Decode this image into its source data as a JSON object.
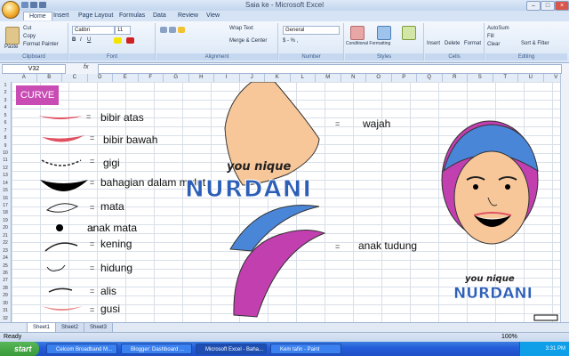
{
  "window": {
    "title": "Saia ke - Microsoft Excel"
  },
  "tabs": [
    "Home",
    "Insert",
    "Page Layout",
    "Formulas",
    "Data",
    "Review",
    "View"
  ],
  "ribbon": {
    "clipboard": {
      "paste": "Paste",
      "cut": "Cut",
      "copy": "Copy",
      "format_painter": "Format Painter",
      "label": "Clipboard"
    },
    "font": {
      "name": "Calibri",
      "size": "11",
      "label": "Font"
    },
    "alignment": {
      "wrap": "Wrap Text",
      "merge": "Merge & Center",
      "label": "Alignment"
    },
    "number": {
      "format": "General",
      "label": "Number"
    },
    "styles": {
      "conditional": "Conditional Formatting",
      "format_table": "Format as Table",
      "cell_styles": "Cell Styles",
      "label": "Styles"
    },
    "cells": {
      "insert": "Insert",
      "delete": "Delete",
      "format": "Format",
      "label": "Cells"
    },
    "editing": {
      "autosum": "AutoSum",
      "fill": "Fill",
      "clear": "Clear",
      "sort": "Sort & Filter",
      "find": "Find & Select",
      "label": "Editing"
    }
  },
  "formula_bar": {
    "name_box": "V32",
    "fx": "fx",
    "value": ""
  },
  "columns": [
    "A",
    "B",
    "C",
    "D",
    "E",
    "F",
    "G",
    "H",
    "I",
    "J",
    "K",
    "L",
    "M",
    "N",
    "O",
    "P",
    "Q",
    "R",
    "S",
    "T",
    "U",
    "V"
  ],
  "rows": [
    "1",
    "2",
    "3",
    "4",
    "5",
    "6",
    "7",
    "8",
    "9",
    "10",
    "11",
    "12",
    "13",
    "14",
    "15",
    "16",
    "17",
    "18",
    "19",
    "20",
    "21",
    "22",
    "23",
    "24",
    "25",
    "26",
    "27",
    "28",
    "29",
    "30",
    "31",
    "32"
  ],
  "content": {
    "curve_label": "CURVE",
    "equals": "=",
    "labels": {
      "bibir_atas": "bibir atas",
      "bibir_bawah": "bibir bawah",
      "gigi": "gigi",
      "dalam_mulut": "bahagian dalam mulut",
      "mata": "mata",
      "anak_mata": "anak mata",
      "kening": "kening",
      "hidung": "hidung",
      "alis": "alis",
      "gusi": "gusi",
      "wajah": "wajah",
      "anak_tudung": "anak tudung"
    },
    "watermark": {
      "top": "you nique",
      "bottom": "NURDANI"
    }
  },
  "sheets": [
    "Sheet1",
    "Sheet2",
    "Sheet3"
  ],
  "status": {
    "left": "Ready",
    "zoom": "100%"
  },
  "taskbar": {
    "start": "start",
    "items": [
      "Celcom Broadband M...",
      "Blogger: Dashboard ...",
      "Microsoft Excel - Baha...",
      "Kem tafin - Paint"
    ],
    "clock": "3:31 PM"
  },
  "colors": {
    "hijab_pink": "#c23fb0",
    "hijab_blue": "#4a86d8",
    "skin": "#f7c79a",
    "lip": "#e05060",
    "accent": "#c94bb4"
  }
}
